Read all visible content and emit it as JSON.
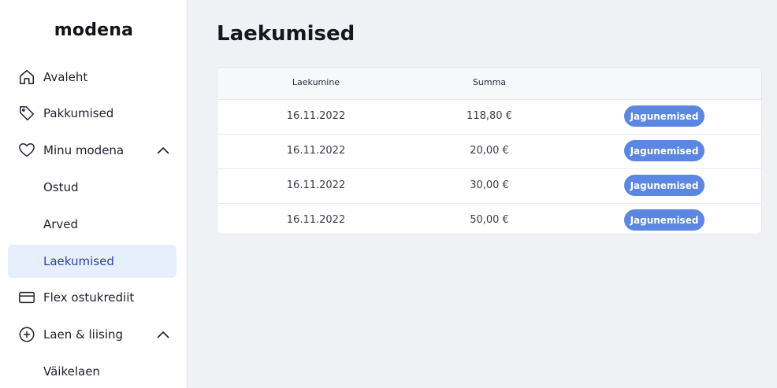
{
  "brand": {
    "logo_text": "modena"
  },
  "sidebar": {
    "items": [
      {
        "label": "Avaleht",
        "icon": "home-icon"
      },
      {
        "label": "Pakkumised",
        "icon": "tag-icon"
      },
      {
        "label": "Minu modena",
        "icon": "heart-icon",
        "expanded": true
      },
      {
        "label": "Ostud"
      },
      {
        "label": "Arved"
      },
      {
        "label": "Laekumised",
        "active": true
      },
      {
        "label": "Flex ostukrediit",
        "icon": "credit-card-icon"
      },
      {
        "label": "Laen & liising",
        "icon": "plus-circle-icon",
        "expanded": true
      },
      {
        "label": "Väikelaen"
      }
    ]
  },
  "main": {
    "title": "Laekumised",
    "table": {
      "columns": [
        "Laekumine",
        "Summa"
      ],
      "rows": [
        {
          "date": "16.11.2022",
          "amount": "118,80 €",
          "action": "Jagunemised"
        },
        {
          "date": "16.11.2022",
          "amount": "20,00 €",
          "action": "Jagunemised"
        },
        {
          "date": "16.11.2022",
          "amount": "30,00 €",
          "action": "Jagunemised"
        },
        {
          "date": "16.11.2022",
          "amount": "50,00 €",
          "action": "Jagunemised"
        }
      ]
    }
  },
  "colors": {
    "accent": "#5b86e2",
    "active_bg": "#e7effc",
    "active_text": "#2a44a8",
    "page_bg": "#f0f1f5"
  }
}
